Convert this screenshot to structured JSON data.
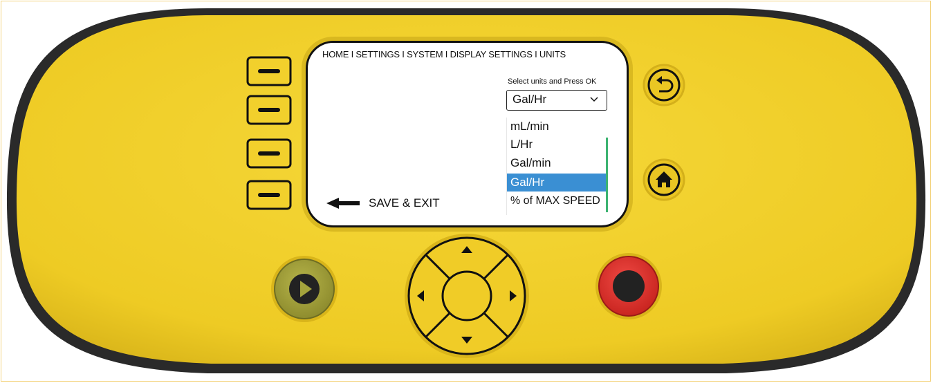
{
  "screen": {
    "breadcrumb": "HOME I SETTINGS I SYSTEM I DISPLAY SETTINGS I UNITS",
    "prompt": "Select units and Press OK",
    "selected_value": "Gal/Hr",
    "options": [
      "mL/min",
      "L/Hr",
      "Gal/min",
      "Gal/Hr",
      "% of MAX SPEED"
    ],
    "selected_index": 3,
    "save_label": "SAVE & EXIT"
  },
  "colors": {
    "body": "#f2d02c",
    "bezel": "#2a2a2a",
    "play": "#a4a33c",
    "stop": "#e4312e",
    "highlight": "#3a8fd3",
    "scrollbar": "#3cb371"
  },
  "icons": {
    "back": "undo-arrow-icon",
    "home": "home-icon",
    "play": "play-icon",
    "stop": "stop-icon",
    "soft_key": "minus-bar-icon",
    "nav_up": "triangle-up-icon",
    "nav_down": "triangle-down-icon",
    "nav_left": "triangle-left-icon",
    "nav_right": "triangle-right-icon"
  }
}
